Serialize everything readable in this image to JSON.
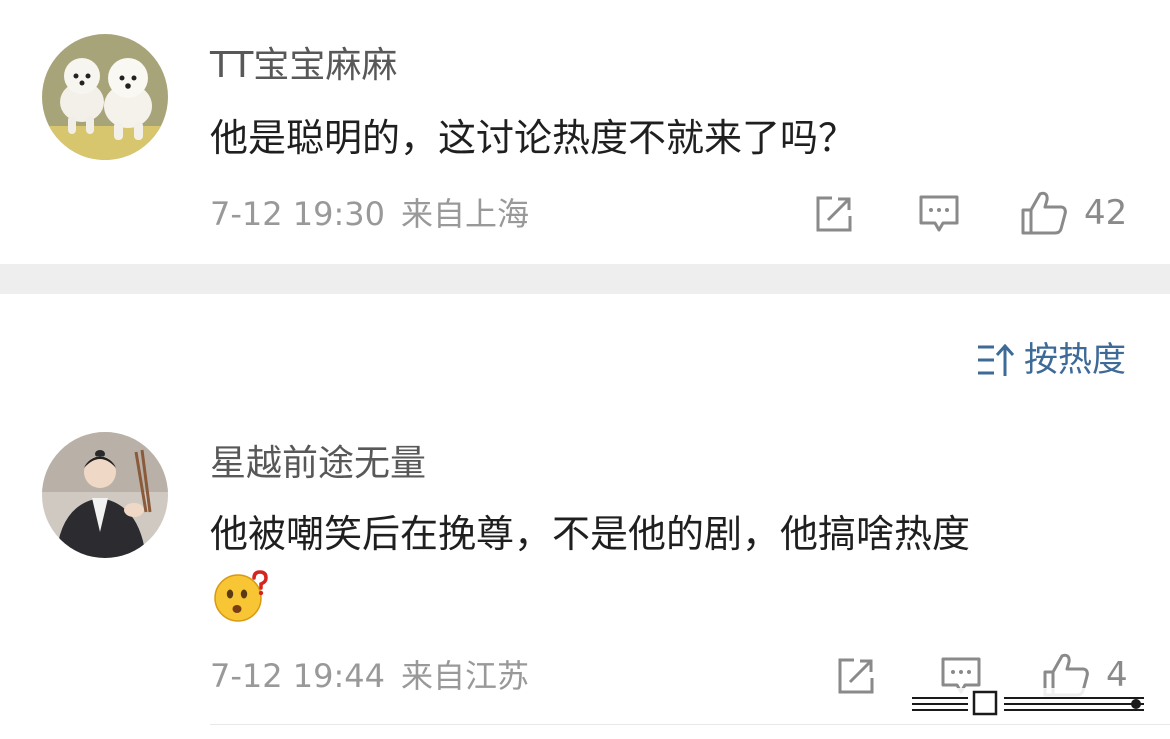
{
  "comments": [
    {
      "username": "TT宝宝麻麻",
      "text": "他是聪明的，这讨论热度不就来了吗？",
      "date": "7-12 19:30",
      "location": "来自上海",
      "likes": "42"
    },
    {
      "username": "星越前途无量",
      "text": "他被嘲笑后在挽尊，不是他的剧，他搞啥热度",
      "date": "7-12 19:44",
      "location": "来自江苏",
      "likes": "4"
    }
  ],
  "sort": {
    "label": "按热度"
  },
  "icons": {
    "share": "share-icon",
    "comment": "comment-icon",
    "like": "thumbs-up-icon",
    "sort": "sort-icon",
    "emoji": "confused-face-emoji"
  },
  "colors": {
    "accent": "#3d6a96",
    "meta": "#999999",
    "divider": "#eeeeee"
  }
}
